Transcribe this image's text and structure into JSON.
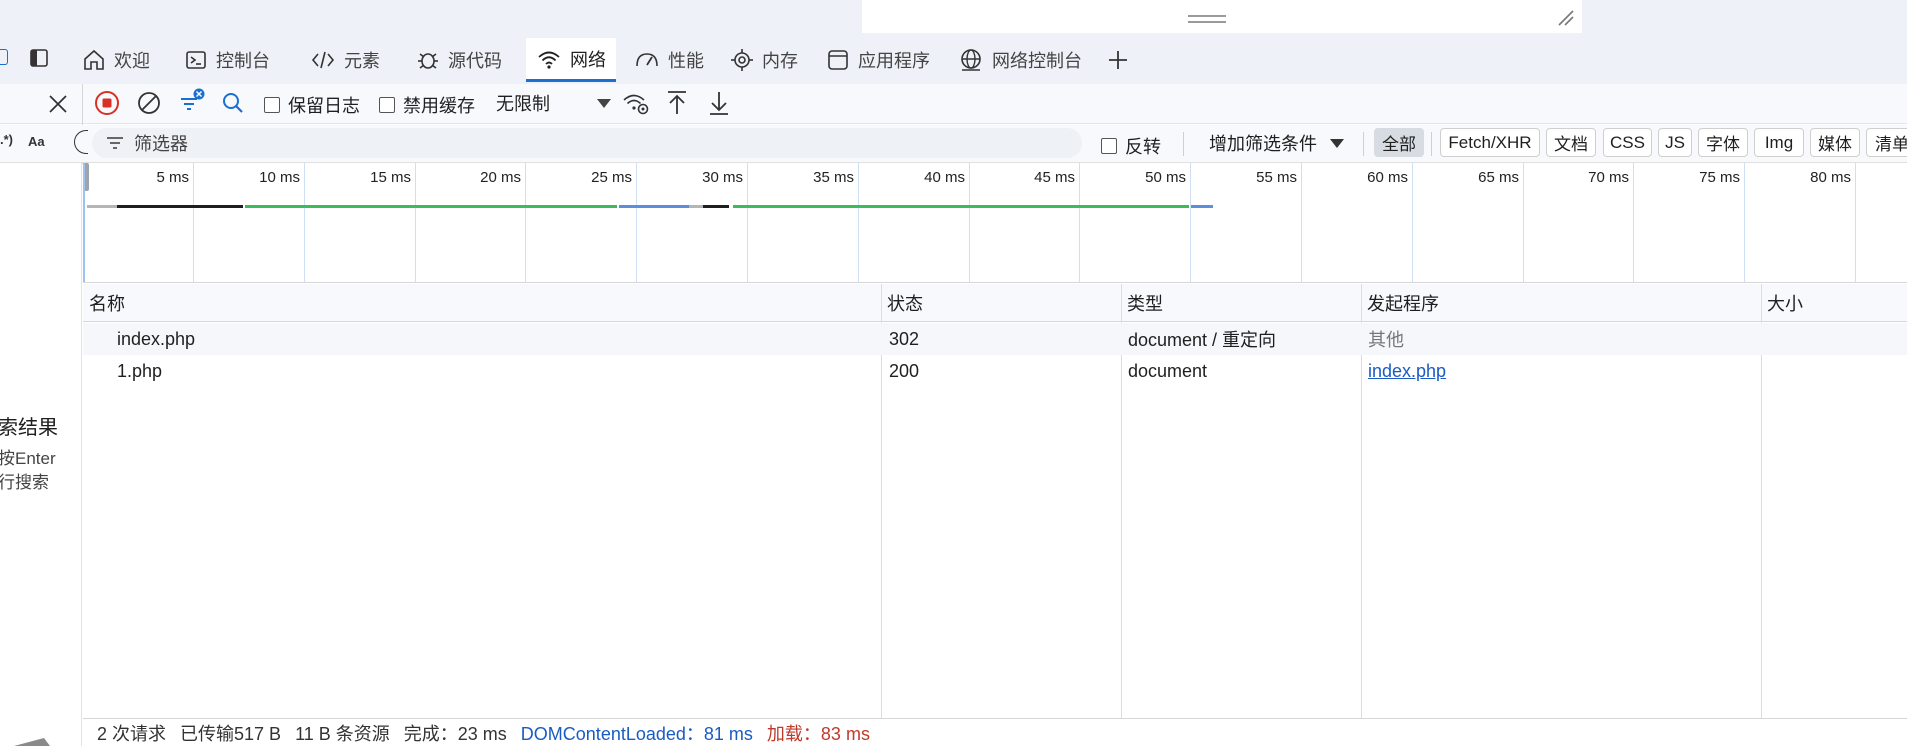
{
  "tabs": [
    {
      "label": "欢迎",
      "icon": "home-icon"
    },
    {
      "label": "控制台",
      "icon": "console-icon"
    },
    {
      "label": "元素",
      "icon": "code-icon"
    },
    {
      "label": "源代码",
      "icon": "bug-icon"
    },
    {
      "label": "网络",
      "icon": "wifi-icon",
      "active": true
    },
    {
      "label": "性能",
      "icon": "gauge-icon"
    },
    {
      "label": "内存",
      "icon": "chip-icon"
    },
    {
      "label": "应用程序",
      "icon": "window-icon"
    },
    {
      "label": "网络控制台",
      "icon": "globe-icon"
    }
  ],
  "toolbar": {
    "preserve_log_label": "保留日志",
    "disable_cache_label": "禁用缓存",
    "throttling_value": "无限制"
  },
  "filter": {
    "placeholder": "筛选器",
    "invert_label": "反转",
    "more_filters_label": "增加筛选条件"
  },
  "type_chips": [
    "全部",
    "Fetch/XHR",
    "文档",
    "CSS",
    "JS",
    "字体",
    "Img",
    "媒体",
    "清单"
  ],
  "left_panel": {
    "regex_label": ".*)",
    "case_label": "Aa",
    "title": "索结果",
    "hint_line1": "按Enter",
    "hint_line2": "行搜索"
  },
  "timeline": {
    "ticks": [
      "5 ms",
      "10 ms",
      "15 ms",
      "20 ms",
      "25 ms",
      "30 ms",
      "35 ms",
      "40 ms",
      "45 ms",
      "50 ms",
      "55 ms",
      "60 ms",
      "65 ms",
      "70 ms",
      "75 ms",
      "80 ms"
    ]
  },
  "table": {
    "headers": {
      "name": "名称",
      "status": "状态",
      "type": "类型",
      "initiator": "发起程序",
      "size": "大小"
    },
    "rows": [
      {
        "name": "index.php",
        "status": "302",
        "type": "document / 重定向",
        "initiator": "其他"
      },
      {
        "name": "1.php",
        "status": "200",
        "type": "document",
        "initiator": "index.php"
      }
    ]
  },
  "statusbar": {
    "requests": "2 次请求",
    "transferred": "已传输517 B",
    "resources": "11 B 条资源",
    "finish": "完成：23 ms",
    "dcl": "DOMContentLoaded：81 ms",
    "load": "加载：83 ms"
  },
  "colors": {
    "accent": "#1a6fd0",
    "record": "#d93025",
    "link": "#1a5bc4",
    "load": "#c0392b"
  }
}
